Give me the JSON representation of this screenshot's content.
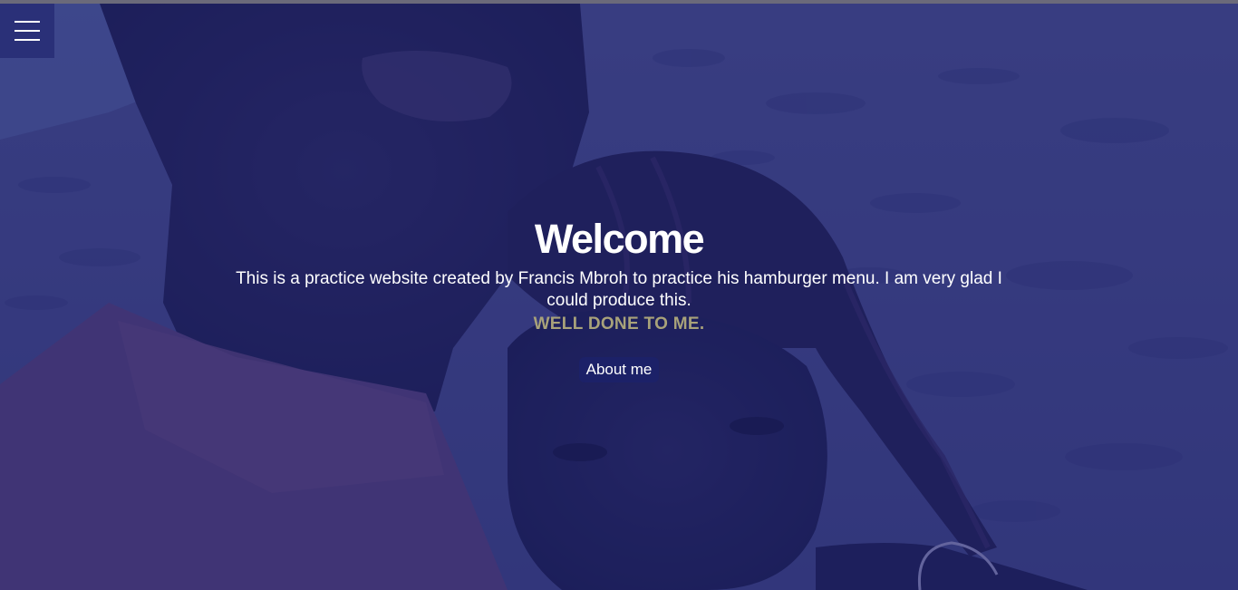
{
  "menu": {
    "icon": "hamburger-menu-icon"
  },
  "hero": {
    "title": "Welcome",
    "description": "This is a practice website created by Francis Mbroh to practice his hamburger menu. I am very glad I could produce this.",
    "highlight": "WELL DONE TO ME.",
    "button_label": "About me"
  },
  "colors": {
    "overlay": "#1e226e",
    "menu_background": "#2a3078",
    "highlight_text": "#a8a27a",
    "button_background": "#1c2168"
  }
}
